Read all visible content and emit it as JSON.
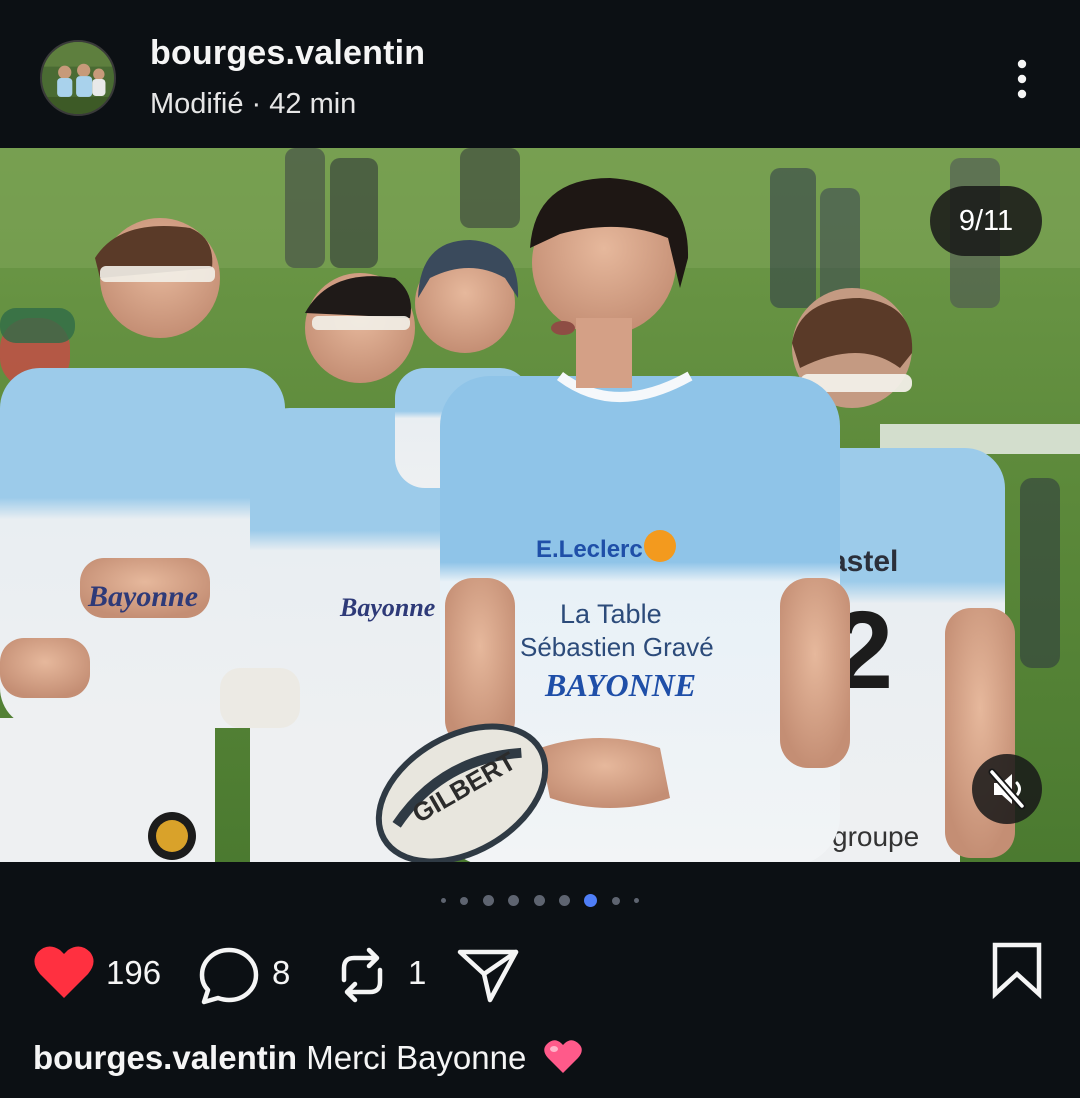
{
  "post": {
    "username": "bourges.valentin",
    "subline": "Modifié · 42 min",
    "avatar_icon": "profile-photo-avatar",
    "more_icon": "vertical-ellipsis-icon"
  },
  "media": {
    "counter": "9/11",
    "mute_icon": "speaker-muted-icon",
    "slide_index": 6,
    "slide_total": 11,
    "scene": {
      "main_jersey_sponsor": "E.Leclerc",
      "main_jersey_line1": "La Table",
      "main_jersey_line2": "Sébastien Gravé",
      "main_jersey_line3": "BAYONNE",
      "ball_brand": "GILBERT",
      "left_jersey_text": "Bayonne",
      "mid_jersey_text": "Bayonne",
      "right_jersey_text": "astel",
      "shorts_text": "groupe"
    }
  },
  "actions": {
    "like_count": "196",
    "comment_count": "8",
    "repost_count": "1",
    "like_color": "#ff3040"
  },
  "caption": {
    "username": "bourges.valentin",
    "text": "Merci Bayonne"
  },
  "colors": {
    "background": "#0c1014",
    "active_dot": "#4f7ef7",
    "jersey_blue": "#8fc4e8"
  }
}
